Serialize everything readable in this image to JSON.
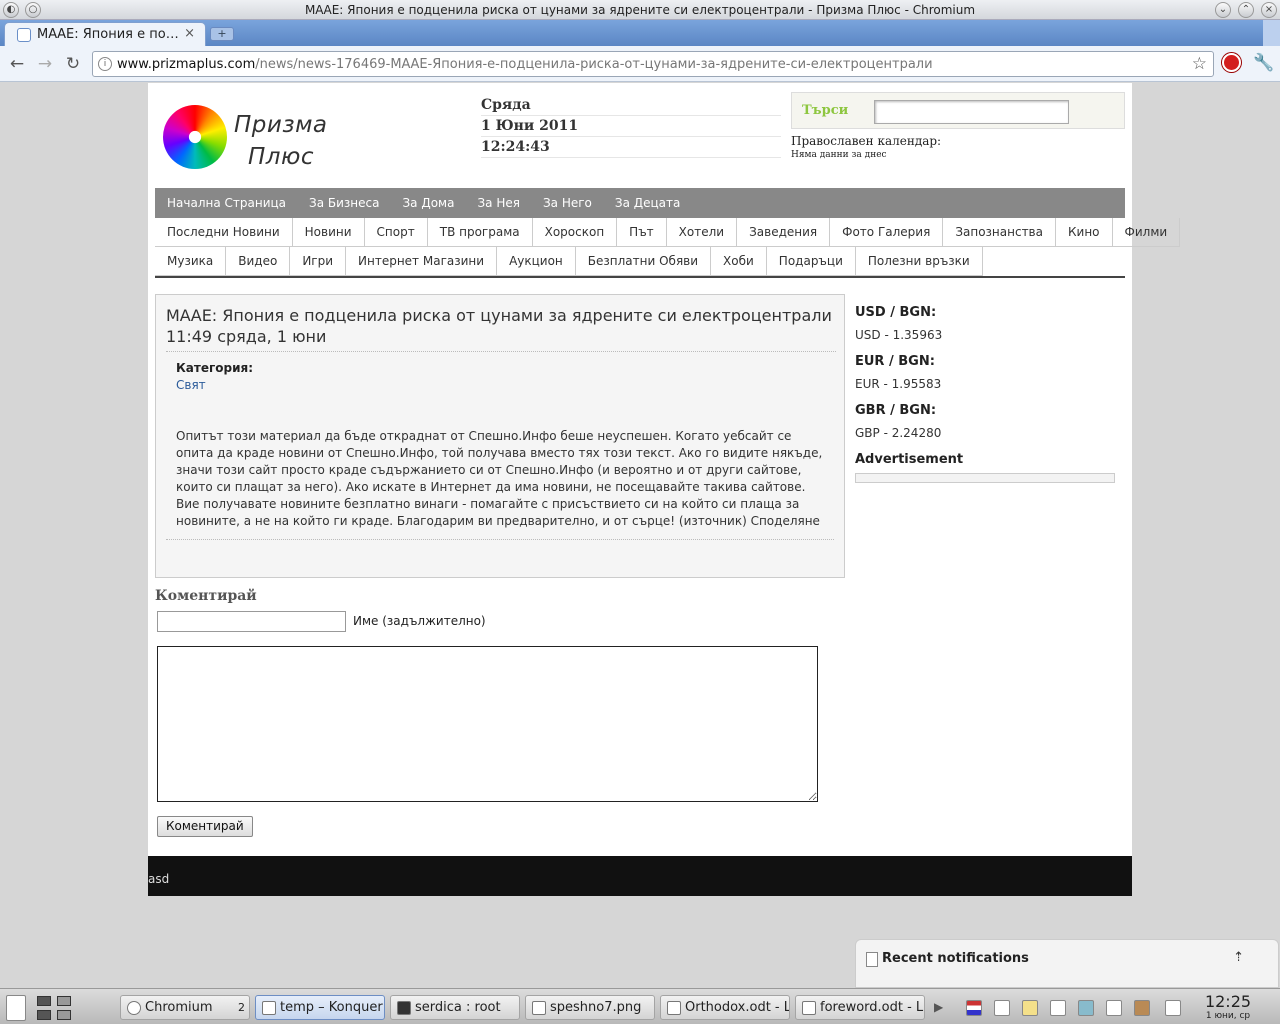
{
  "window": {
    "title": "МААЕ: Япония е подценила риска от цунами за ядрените си електроцентрали - Призма Плюс - Chromium"
  },
  "browser": {
    "tab_title": "МААЕ: Япония е по…",
    "new_tab": "+",
    "close": "×",
    "url_host": "www.prizmaplus.com",
    "url_path": "/news/news-176469-МААЕ-Япония-е-подценила-риска-от-цунами-за-ядрените-си-електроцентрали"
  },
  "site": {
    "logo_line1": "Призма",
    "logo_line2": "Плюс",
    "weekday": "Сряда",
    "date": "1 Юни 2011",
    "time": "12:24:43",
    "search_label": "Търси",
    "orth_label": "Православен календар:",
    "orth_value": "Няма данни за днес",
    "nav_main": [
      "Начална Страница",
      "За Бизнеса",
      "За Дома",
      "За Нея",
      "За Него",
      "За Децата"
    ],
    "nav_row1": [
      "Последни Новини",
      "Новини",
      "Спорт",
      "ТВ програма",
      "Хороскоп",
      "Път",
      "Хотели",
      "Заведения",
      "Фото Галерия",
      "Запознанства",
      "Кино",
      "Филми"
    ],
    "nav_row2": [
      "Музика",
      "Видео",
      "Игри",
      "Интернет Магазини",
      "Аукцион",
      "Безплатни Обяви",
      "Хоби",
      "Подаръци",
      "Полезни връзки"
    ]
  },
  "article": {
    "title": "МААЕ: Япония е подценила риска от цунами за ядрените си електроцентрали 11:49 сряда, 1 юни",
    "category_label": "Категория:",
    "category": "Свят",
    "body": "Опитът този материал да бъде откраднат от Спешно.Инфо беше неуспешен. Когато уебсайт се опита да краде новини от Спешно.Инфо, той получава вместо тях този текст. Ако го видите някъде, значи този сайт просто краде съдържанието си от Спешно.Инфо (и вероятно и от други сайтове, които си плащат за него). Ако искате в Интернет да има новини, не посещавайте такива сайтове. Вие получавате новините безплатно винаги - помагайте с присъствието си на който си плаща за новините, а не на който ги краде. Благодарим ви предварително, и от сърце! (източник) Споделяне"
  },
  "sidebar": {
    "usd_h": "USD / BGN:",
    "usd_v": "USD - 1.35963",
    "eur_h": "EUR / BGN:",
    "eur_v": "EUR - 1.95583",
    "gbr_h": "GBR / BGN:",
    "gbr_v": "GBP - 2.24280",
    "adv": "Advertisement"
  },
  "comment": {
    "heading": "Коментирай",
    "name_label": "Име (задължително)",
    "name_value": "",
    "submit": "Коментирай"
  },
  "footer": {
    "text": "asd"
  },
  "notifications": {
    "title": "Recent notifications"
  },
  "taskbar": {
    "tasks": [
      {
        "label": "Chromium",
        "count": "2"
      },
      {
        "label": "temp – Konquer"
      },
      {
        "label": "serdica : root"
      },
      {
        "label": "speshno7.png"
      },
      {
        "label": "Orthodox.odt - L"
      },
      {
        "label": "foreword.odt - L"
      }
    ],
    "clock": "12:25",
    "date": "1 юни, ср"
  }
}
